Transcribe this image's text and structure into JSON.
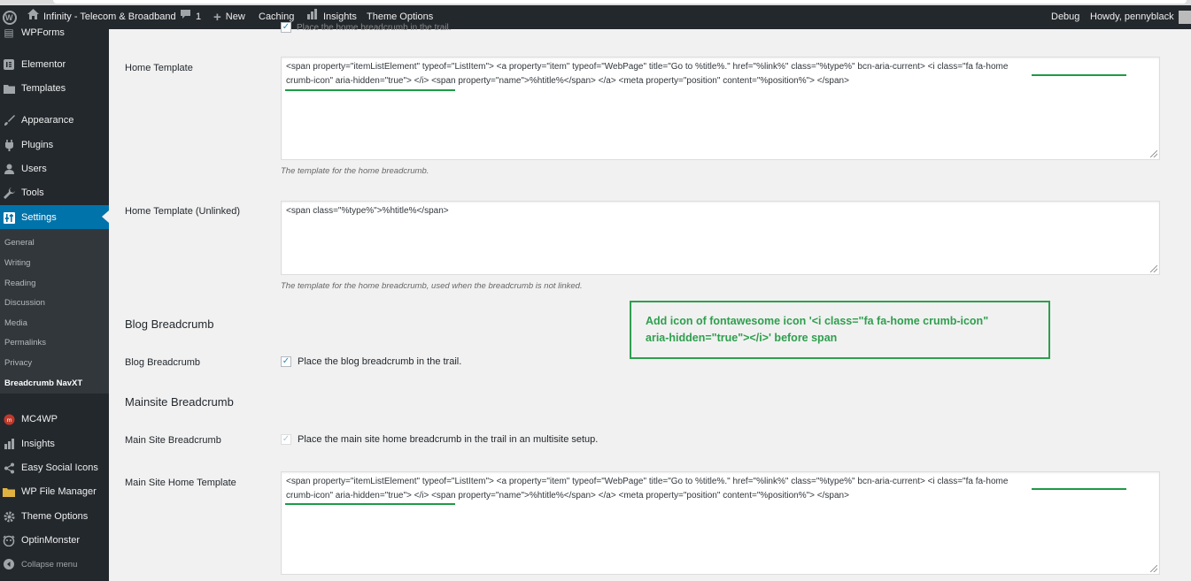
{
  "colors": {
    "admin_bg": "#23282d",
    "active_menu": "#0073aa",
    "annotation_green": "#2e9f4e"
  },
  "adminbar": {
    "site_name": "Infinity - Telecom & Broadband",
    "comments_count": "1",
    "new_label": "New",
    "caching_label": "Caching",
    "insights_label": "Insights",
    "theme_options_label": "Theme Options",
    "debug_label": "Debug",
    "howdy_label": "Howdy, pennyblack"
  },
  "sidebar": {
    "items": [
      {
        "label": "WPForms",
        "icon": "wpforms-icon"
      },
      {
        "label": "Elementor",
        "icon": "elementor-icon"
      },
      {
        "label": "Templates",
        "icon": "folder-icon"
      },
      {
        "label": "Appearance",
        "icon": "brush-icon"
      },
      {
        "label": "Plugins",
        "icon": "plugin-icon"
      },
      {
        "label": "Users",
        "icon": "users-icon"
      },
      {
        "label": "Tools",
        "icon": "wrench-icon"
      },
      {
        "label": "Settings",
        "icon": "settings-icon"
      },
      {
        "label": "MC4WP",
        "icon": "mc4wp-icon"
      },
      {
        "label": "Insights",
        "icon": "bar-chart-icon"
      },
      {
        "label": "Easy Social Icons",
        "icon": "share-icon"
      },
      {
        "label": "WP File Manager",
        "icon": "folder-icon"
      },
      {
        "label": "Theme Options",
        "icon": "gear-icon"
      },
      {
        "label": "OptinMonster",
        "icon": "optinmonster-icon"
      },
      {
        "label": "Collapse menu",
        "icon": "collapse-icon"
      }
    ],
    "submenu": [
      "General",
      "Writing",
      "Reading",
      "Discussion",
      "Media",
      "Permalinks",
      "Privacy",
      "Breadcrumb NavXT"
    ]
  },
  "main": {
    "partial_top_text": "Place the home breadcrumb in the trail.",
    "home_template": {
      "label": "Home Template",
      "line1": "<span property=\"itemListElement\" typeof=\"ListItem\"> <a property=\"item\" typeof=\"WebPage\" title=\"Go to %title%.\" href=\"%link%\" class=\"%type%\" bcn-aria-current> <i class=\"fa fa-home",
      "line2": "crumb-icon\" aria-hidden=\"true\"> </i> <span property=\"name\">%htitle%</span> </a> <meta property=\"position\" content=\"%position%\"> </span>",
      "description": "The template for the home breadcrumb."
    },
    "home_template_unlinked": {
      "label": "Home Template (Unlinked)",
      "value": "<span class=\"%type%\">%htitle%</span>",
      "description": "The template for the home breadcrumb, used when the breadcrumb is not linked."
    },
    "blog_heading": "Blog Breadcrumb",
    "blog_breadcrumb": {
      "label": "Blog Breadcrumb",
      "checkbox_label": "Place the blog breadcrumb in the trail.",
      "checked": true
    },
    "mainsite_heading": "Mainsite Breadcrumb",
    "main_site_breadcrumb": {
      "label": "Main Site Breadcrumb",
      "checkbox_label": "Place the main site home breadcrumb in the trail in an multisite setup.",
      "checked": true,
      "disabled": true
    },
    "main_site_home_template": {
      "label": "Main Site Home Template",
      "line1": "<span property=\"itemListElement\" typeof=\"ListItem\"> <a property=\"item\" typeof=\"WebPage\" title=\"Go to %title%.\" href=\"%link%\" class=\"%type%\" bcn-aria-current> <i class=\"fa fa-home",
      "line2": "crumb-icon\" aria-hidden=\"true\"> </i> <span property=\"name\">%htitle%</span> </a> <meta property=\"position\" content=\"%position%\"> </span>"
    }
  },
  "annotation": {
    "line1": "Add icon of fontawesome icon '<i class=\"fa fa-home crumb-icon\"",
    "line2": "aria-hidden=\"true\"></i>' before span"
  }
}
